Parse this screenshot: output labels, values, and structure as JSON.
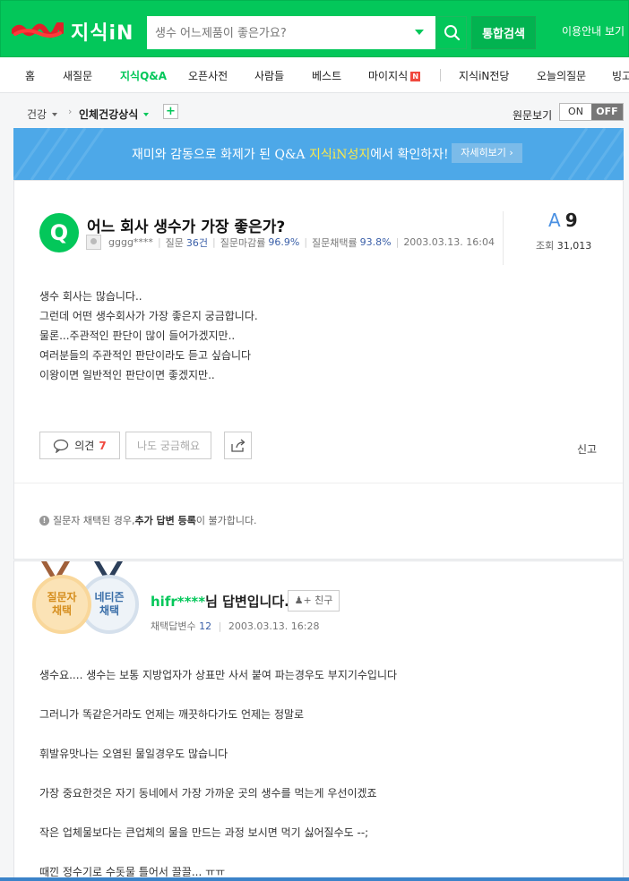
{
  "header": {
    "logo_text": "지식iN",
    "search_placeholder": "생수 어느제품이 좋은가요?",
    "integrated_search_label": "통합검색",
    "top_links": "이용안내 보기",
    "brand_color": "#03c75a"
  },
  "nav": {
    "items": [
      {
        "label": "홈"
      },
      {
        "label": "새질문"
      },
      {
        "label": "지식Q&A"
      },
      {
        "label": "오픈사전"
      },
      {
        "label": "사람들"
      },
      {
        "label": "베스트"
      },
      {
        "label": "마이지식"
      },
      {
        "label": "지식iN전당"
      },
      {
        "label": "오늘의질문"
      },
      {
        "label": "빙고"
      }
    ],
    "new_badge": "N"
  },
  "breadcrumb": {
    "category": "건강",
    "subcategory": "인체건강상식",
    "add_label": "+",
    "original_view_label": "원문보기",
    "toggle_on": "ON",
    "toggle_off": "OFF"
  },
  "banner": {
    "text_before": "재미와 감동으로 화제가 된 Q&A ",
    "highlight": "지식iN성지",
    "text_after": "에서 확인하자!",
    "button_label": "자세히보기 ›"
  },
  "question": {
    "icon_letter": "Q",
    "title": "어느 회사 생수가 가장 좋은가?",
    "author": "gggg****",
    "question_label": "질문",
    "question_count": "36건",
    "close_rate_label": "질문마감률",
    "close_rate": "96.9%",
    "adopt_rate_label": "질문채택률",
    "adopt_rate": "93.8%",
    "date": "2003.03.13. 16:04",
    "answer_letter": "A",
    "answer_count": "9",
    "views_label": "조회",
    "views": "31,013",
    "body": "생수 회사는 많습니다..\n그런데 어떤 생수회사가 가장 좋은지 궁금합니다.\n물론...주관적인 판단이 많이 들어가겠지만..\n여러분들의 주관적인 판단이라도 듣고 싶습니다\n이왕이면 일반적인 판단이면 좋겠지만..",
    "opinion_label": "의견",
    "opinion_count": "7",
    "curious_label": "나도 궁금해요",
    "report_label": "신고",
    "notice_icon": "!",
    "notice_before": "질문자 채택된 경우, ",
    "notice_strong": "추가 답변 등록",
    "notice_after": "이 불가합니다."
  },
  "answer": {
    "medal_questioner_line1": "질문자",
    "medal_questioner_line2": "채택",
    "medal_netizen_line1": "네티즌",
    "medal_netizen_line2": "채택",
    "user": "hifr****",
    "title_suffix": "님 답변입니다.",
    "friend_label": "친구",
    "adopted_label": "채택답변수",
    "adopted_count": "12",
    "date": "2003.03.13. 16:28",
    "paragraphs": [
      "생수요.... 생수는 보통 지방업자가 상표만 사서 붙여 파는경우도 부지기수입니다",
      "그러니가 똑같은거라도 언제는 깨끗하다가도 언제는 정말로",
      "휘발유맛나는 오염된 물일경우도 많습니다",
      "가장 중요한것은 자기 동네에서 가장 가까운 곳의 생수를 먹는게 우선이겠죠",
      "작은 업체물보다는 큰업체의 물을 만드는 과정 보시면 먹기 싫어질수도 --;",
      "때낀 정수기로 수돗물 틀어서 끌끌... ㅠㅠ"
    ]
  }
}
